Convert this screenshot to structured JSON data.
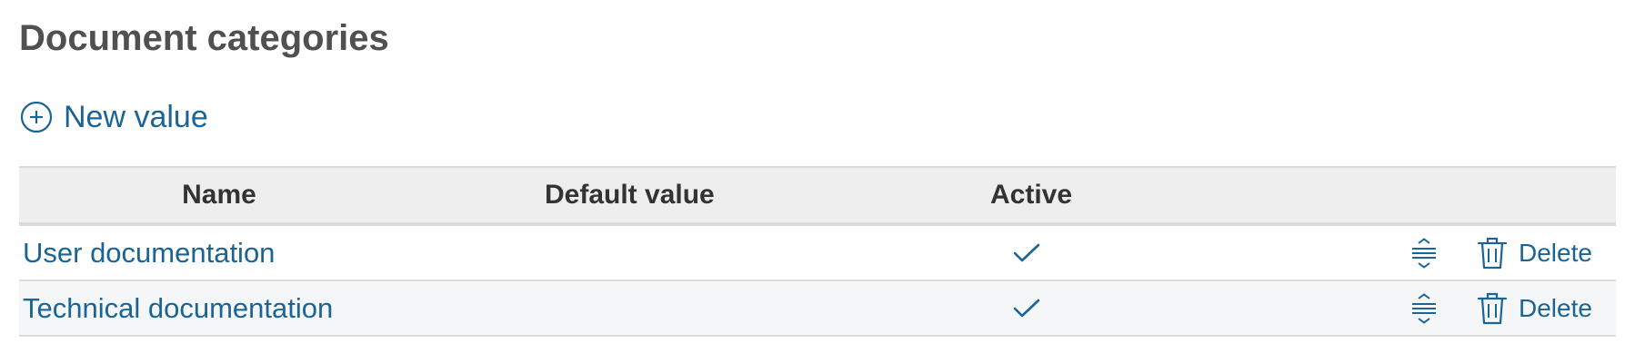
{
  "page": {
    "title": "Document categories"
  },
  "actions": {
    "new_value_label": "New value"
  },
  "table": {
    "columns": {
      "name": "Name",
      "default_value": "Default value",
      "active": "Active"
    },
    "rows": [
      {
        "name": "User documentation",
        "default_value": "",
        "active": true,
        "delete_label": "Delete"
      },
      {
        "name": "Technical documentation",
        "default_value": "",
        "active": true,
        "delete_label": "Delete"
      }
    ]
  },
  "colors": {
    "link": "#1a6496",
    "title": "#505050",
    "header_bg": "#eeeeee",
    "row_alt_bg": "#f5f6f8"
  },
  "icons": {
    "new_value": "plus-circle-icon",
    "active": "checkmark-icon",
    "sort": "sort-handle-icon",
    "delete": "trash-icon"
  }
}
